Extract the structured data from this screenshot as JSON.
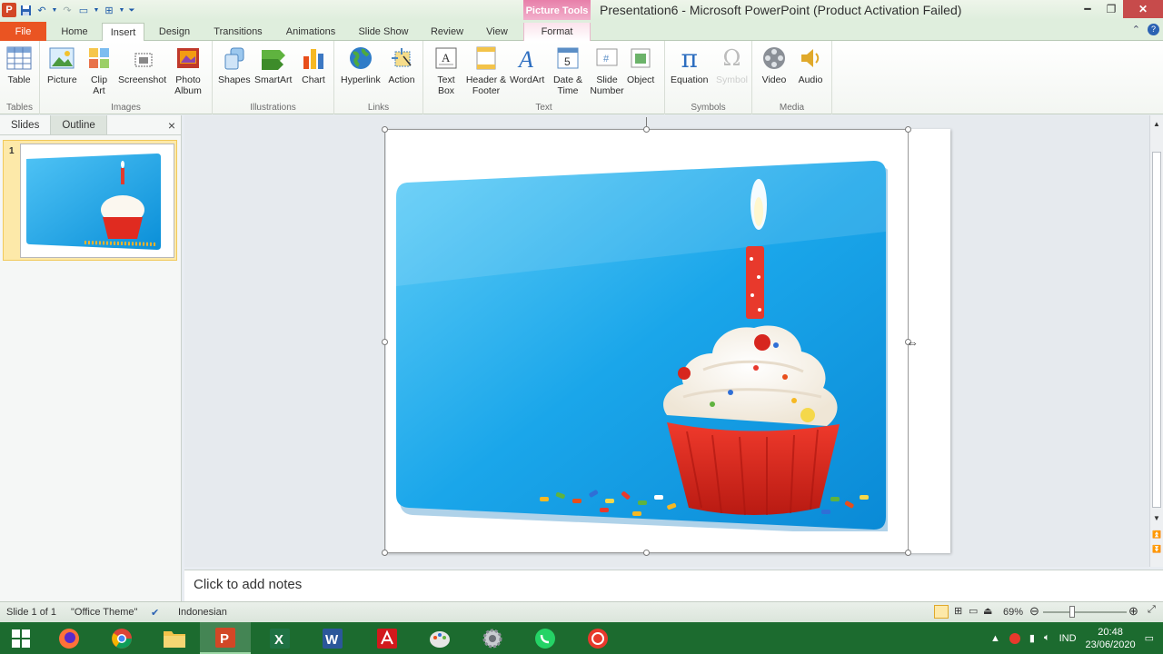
{
  "window": {
    "title": "Presentation6  -  Microsoft PowerPoint (Product Activation Failed)",
    "context_tab_header": "Picture Tools"
  },
  "tabs": [
    "File",
    "Home",
    "Insert",
    "Design",
    "Transitions",
    "Animations",
    "Slide Show",
    "Review",
    "View",
    "Format"
  ],
  "active_tab": "Insert",
  "ribbon": {
    "groups": {
      "tables": "Tables",
      "images": "Images",
      "illustrations": "Illustrations",
      "links": "Links",
      "text": "Text",
      "symbols": "Symbols",
      "media": "Media"
    },
    "buttons": {
      "table": "Table",
      "picture": "Picture",
      "clip_art": "Clip Art",
      "screenshot": "Screenshot",
      "photo_album": "Photo Album",
      "shapes": "Shapes",
      "smartart": "SmartArt",
      "chart": "Chart",
      "hyperlink": "Hyperlink",
      "action": "Action",
      "text_box": "Text Box",
      "header_footer": "Header & Footer",
      "wordart": "WordArt",
      "date_time": "Date & Time",
      "slide_number": "Slide Number",
      "object": "Object",
      "equation": "Equation",
      "symbol": "Symbol",
      "video": "Video",
      "audio": "Audio"
    }
  },
  "slide_panel": {
    "tab_slides": "Slides",
    "tab_outline": "Outline",
    "close": "×",
    "thumbnail_number": "1"
  },
  "notes": {
    "placeholder": "Click to add notes"
  },
  "status": {
    "slide": "Slide 1 of 1",
    "theme": "\"Office Theme\"",
    "language": "Indonesian",
    "zoom": "69%"
  },
  "taskbar": {
    "time": "20:48",
    "date": "23/06/2020",
    "language": "IND"
  },
  "colors": {
    "file_tab": "#ea5422",
    "photo_blue": "#1aa3e6",
    "taskbar": "#1c6b2f"
  }
}
